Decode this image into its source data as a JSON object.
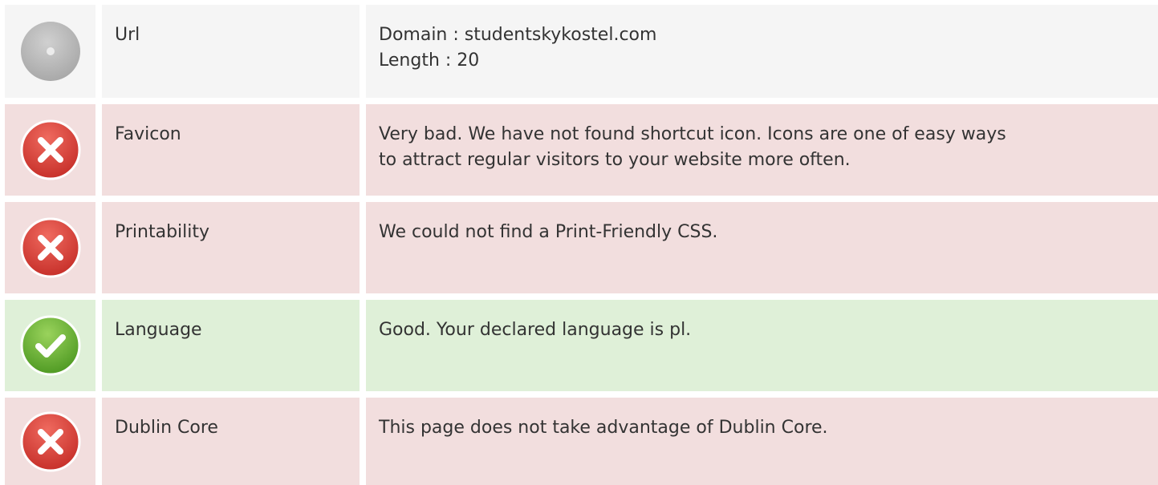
{
  "rows": [
    {
      "status": "neutral",
      "icon": "neutral-circle-icon",
      "label": "Url",
      "lines": [
        "Domain : studentskykostel.com",
        "Length : 20"
      ]
    },
    {
      "status": "bad",
      "icon": "error-icon",
      "label": "Favicon",
      "lines": [
        "Very bad. We have not found shortcut icon. Icons are one of easy ways",
        "to attract regular visitors to your website more often."
      ]
    },
    {
      "status": "bad",
      "icon": "error-icon",
      "label": "Printability",
      "lines": [
        "We could not find a Print-Friendly CSS."
      ]
    },
    {
      "status": "good",
      "icon": "check-icon",
      "label": "Language",
      "lines": [
        "Good. Your declared language is pl."
      ]
    },
    {
      "status": "bad",
      "icon": "error-icon",
      "label": "Dublin Core",
      "lines": [
        "This page does not take advantage of Dublin Core."
      ]
    }
  ],
  "colors": {
    "neutral_bg": "#f5f5f5",
    "bad_bg": "#f2dede",
    "good_bg": "#dff0d8",
    "error_red": "#d9413a",
    "ok_green": "#6db33f"
  }
}
